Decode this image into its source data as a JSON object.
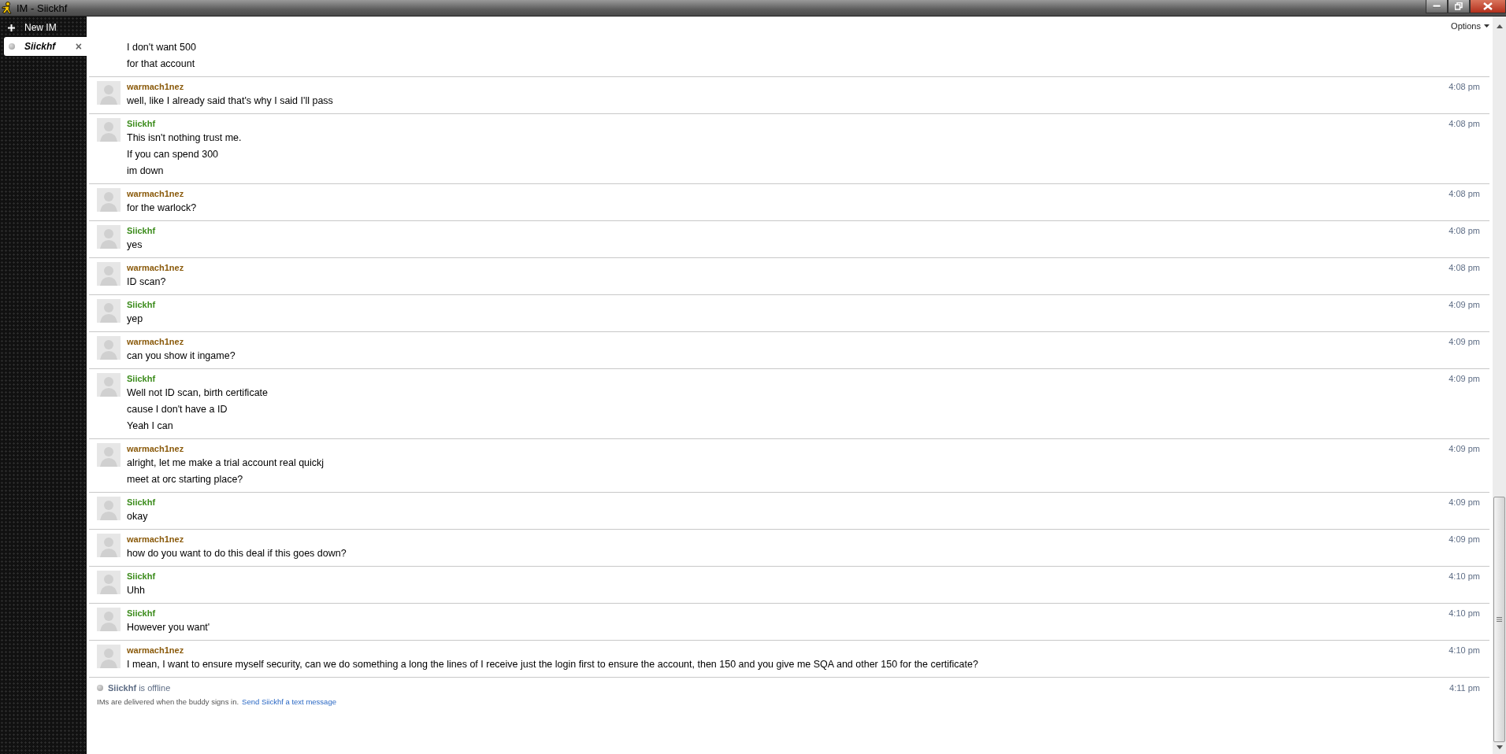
{
  "window": {
    "title": "IM - Siickhf"
  },
  "sidebar": {
    "new_im": "New IM",
    "tabs": [
      {
        "label": "Siickhf",
        "selected": true,
        "close": "×"
      }
    ]
  },
  "options": "Options",
  "messages": [
    {
      "lines": [
        "I don't want 500",
        "for that account"
      ]
    },
    {
      "sender": "warmach1nez",
      "color": "#8a5a0b",
      "time": "4:08 pm",
      "lines": [
        "well, like I already said that's why I said I'll pass"
      ]
    },
    {
      "sender": "Siickhf",
      "color": "#3c8c1c",
      "time": "4:08 pm",
      "lines": [
        "This isn't nothing trust me.",
        "If you can spend 300",
        "im down"
      ]
    },
    {
      "sender": "warmach1nez",
      "color": "#8a5a0b",
      "time": "4:08 pm",
      "lines": [
        "for the warlock?"
      ]
    },
    {
      "sender": "Siickhf",
      "color": "#3c8c1c",
      "time": "4:08 pm",
      "lines": [
        "yes"
      ]
    },
    {
      "sender": "warmach1nez",
      "color": "#8a5a0b",
      "time": "4:08 pm",
      "lines": [
        "ID scan?"
      ]
    },
    {
      "sender": "Siickhf",
      "color": "#3c8c1c",
      "time": "4:09 pm",
      "lines": [
        "yep"
      ]
    },
    {
      "sender": "warmach1nez",
      "color": "#8a5a0b",
      "time": "4:09 pm",
      "lines": [
        "can you show it ingame?"
      ]
    },
    {
      "sender": "Siickhf",
      "color": "#3c8c1c",
      "time": "4:09 pm",
      "lines": [
        "Well not ID scan, birth certificate",
        "cause I don't have a ID",
        "Yeah I can"
      ]
    },
    {
      "sender": "warmach1nez",
      "color": "#8a5a0b",
      "time": "4:09 pm",
      "lines": [
        "alright, let me make a trial account real quickj",
        "meet at orc starting place?"
      ]
    },
    {
      "sender": "Siickhf",
      "color": "#3c8c1c",
      "time": "4:09 pm",
      "lines": [
        "okay"
      ]
    },
    {
      "sender": "warmach1nez",
      "color": "#8a5a0b",
      "time": "4:09 pm",
      "lines": [
        "how do you want to do this deal if this goes down?"
      ]
    },
    {
      "sender": "Siickhf",
      "color": "#3c8c1c",
      "time": "4:10 pm",
      "lines": [
        "Uhh"
      ]
    },
    {
      "sender": "Siickhf",
      "color": "#3c8c1c",
      "time": "4:10 pm",
      "lines": [
        "However you want'"
      ]
    },
    {
      "sender": "warmach1nez",
      "color": "#8a5a0b",
      "time": "4:10 pm",
      "lines": [
        "I mean, I want to ensure myself security, can we do something a long the lines of I receive just the login first to ensure the account, then 150 and you give me SQA and other 150 for the certificate?"
      ]
    }
  ],
  "status": {
    "text": "**Siickhf** is offline",
    "time": "4:11 pm"
  },
  "notice": {
    "text": "IMs are delivered when the buddy signs in.",
    "link": "Send Siickhf a text message"
  }
}
